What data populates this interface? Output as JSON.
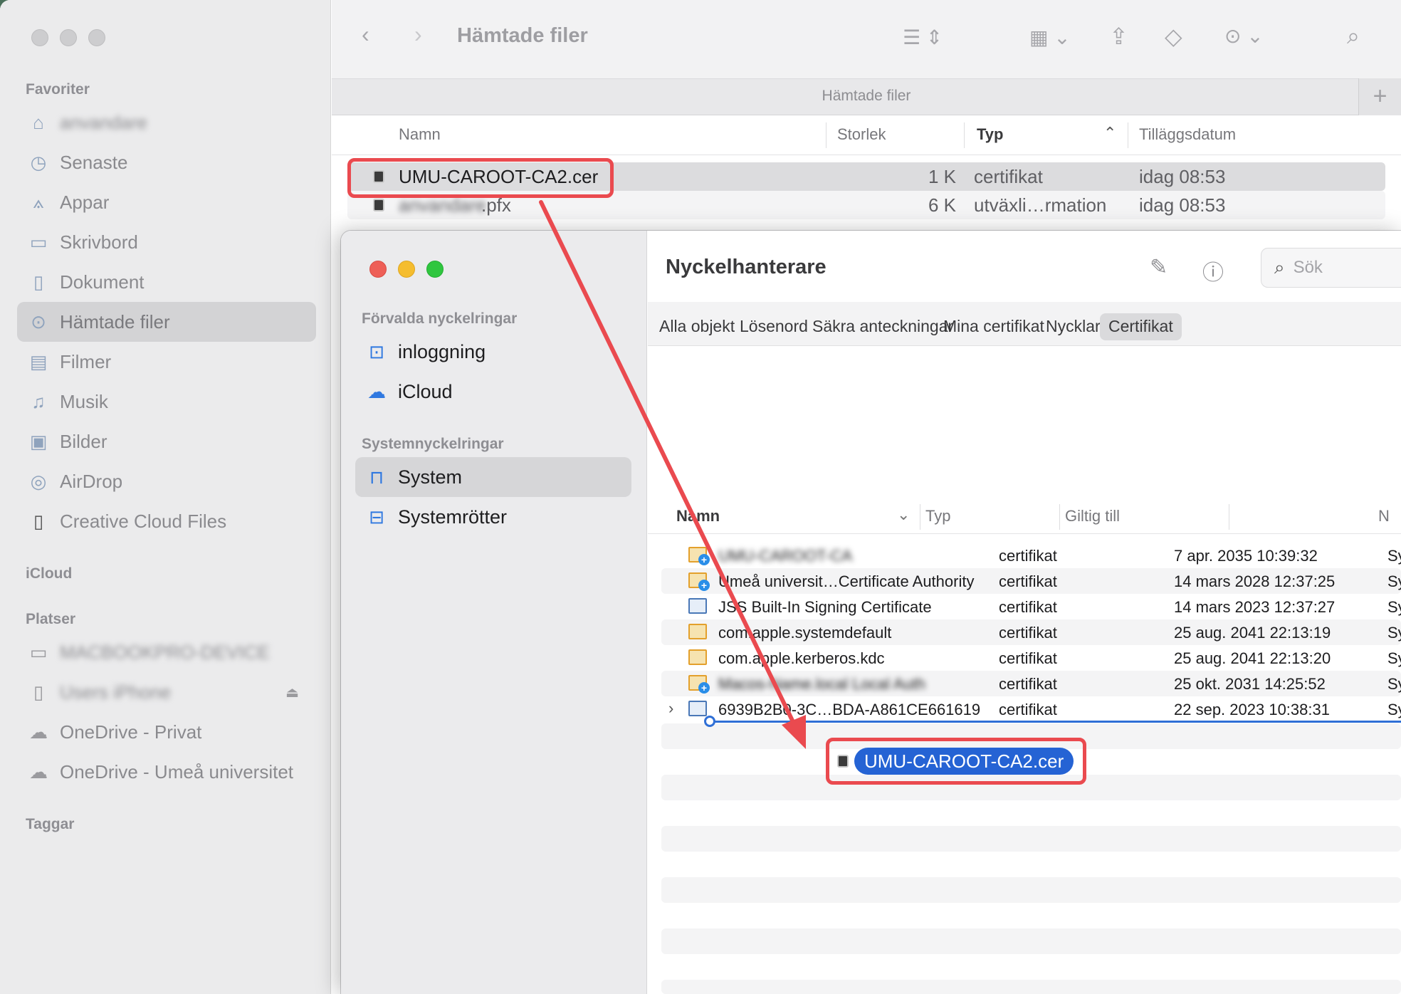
{
  "finder": {
    "title": "Hämtade filer",
    "tab_label": "Hämtade filer",
    "tab_add": "+",
    "sidebar": {
      "sections": {
        "favorites": "Favoriter",
        "icloud": "iCloud",
        "locations": "Platser",
        "tags": "Taggar"
      },
      "items": [
        {
          "label": "anvandare",
          "icon": "house-icon"
        },
        {
          "label": "Senaste",
          "icon": "clock-icon"
        },
        {
          "label": "Appar",
          "icon": "apps-icon"
        },
        {
          "label": "Skrivbord",
          "icon": "desktop-icon"
        },
        {
          "label": "Dokument",
          "icon": "document-icon"
        },
        {
          "label": "Hämtade filer",
          "icon": "download-icon"
        },
        {
          "label": "Filmer",
          "icon": "film-icon"
        },
        {
          "label": "Musik",
          "icon": "music-icon"
        },
        {
          "label": "Bilder",
          "icon": "photo-icon"
        },
        {
          "label": "AirDrop",
          "icon": "airdrop-icon"
        },
        {
          "label": "Creative Cloud Files",
          "icon": "file-icon"
        }
      ],
      "locations": [
        {
          "label": "MACBOOKPRO-DEVICE",
          "icon": "laptop-icon"
        },
        {
          "label": "Users iPhone",
          "icon": "phone-icon"
        },
        {
          "label": "OneDrive - Privat",
          "icon": "cloud-icon"
        },
        {
          "label": "OneDrive - Umeå universitet",
          "icon": "cloud-icon"
        }
      ]
    },
    "columns": {
      "name": "Namn",
      "size": "Storlek",
      "type": "Typ",
      "date": "Tilläggsdatum"
    },
    "files": [
      {
        "name": "UMU-CAROOT-CA2.cer",
        "size": "1 K",
        "type": "certifikat",
        "date": "idag 08:53"
      },
      {
        "name_blur": "anvandare",
        "name_ext": ".pfx",
        "size": "6 K",
        "type": "utväxli…rmation",
        "date": "idag 08:53"
      }
    ]
  },
  "keychain": {
    "title": "Nyckelhanterare",
    "search_placeholder": "Sök",
    "sections": {
      "default": "Förvalda nyckelringar",
      "system": "Systemnyckelringar"
    },
    "keychains": [
      {
        "label": "inloggning",
        "icon": "unlocked-icon"
      },
      {
        "label": "iCloud",
        "icon": "cloud-key-icon"
      },
      {
        "label": "System",
        "icon": "lock-icon"
      },
      {
        "label": "Systemrötter",
        "icon": "lock-box-icon"
      }
    ],
    "tabs": [
      "Alla objekt",
      "Lösenord",
      "Säkra anteckningar",
      "Mina certifikat",
      "Nycklar",
      "Certifikat"
    ],
    "active_tab": "Certifikat",
    "columns": {
      "name": "Namn",
      "type": "Typ",
      "expires": "Giltig till",
      "keychain": "N"
    },
    "certificates": [
      {
        "name": "UMU-CAROOT-CA",
        "blur": true,
        "type": "certifikat",
        "expires": "7 apr. 2035 10:39:32",
        "keychain": "Sy"
      },
      {
        "name": "Umeå universit…Certificate Authority",
        "type": "certifikat",
        "expires": "14 mars 2028 12:37:25",
        "keychain": "Sy"
      },
      {
        "name": "JSS Built-In Signing Certificate",
        "type": "certifikat",
        "expires": "14 mars 2023 12:37:27",
        "keychain": "Sy"
      },
      {
        "name": "com.apple.systemdefault",
        "type": "certifikat",
        "expires": "25 aug. 2041 22:13:19",
        "keychain": "Sy"
      },
      {
        "name": "com.apple.kerberos.kdc",
        "type": "certifikat",
        "expires": "25 aug. 2041 22:13:20",
        "keychain": "Sy"
      },
      {
        "name": "Macos-Name.local Local Auth",
        "blur": true,
        "type": "certifikat",
        "expires": "25 okt. 2031 14:25:52",
        "keychain": "Sy"
      },
      {
        "name": "6939B2B0-3C…BDA-A861CE661619",
        "type": "certifikat",
        "expires": "22 sep. 2023 10:38:31",
        "keychain": "Sy"
      }
    ],
    "drag_item": "UMU-CAROOT-CA2.cer"
  },
  "colors": {
    "annotation": "#ea4a4f",
    "selection_blue": "#2563d4"
  }
}
